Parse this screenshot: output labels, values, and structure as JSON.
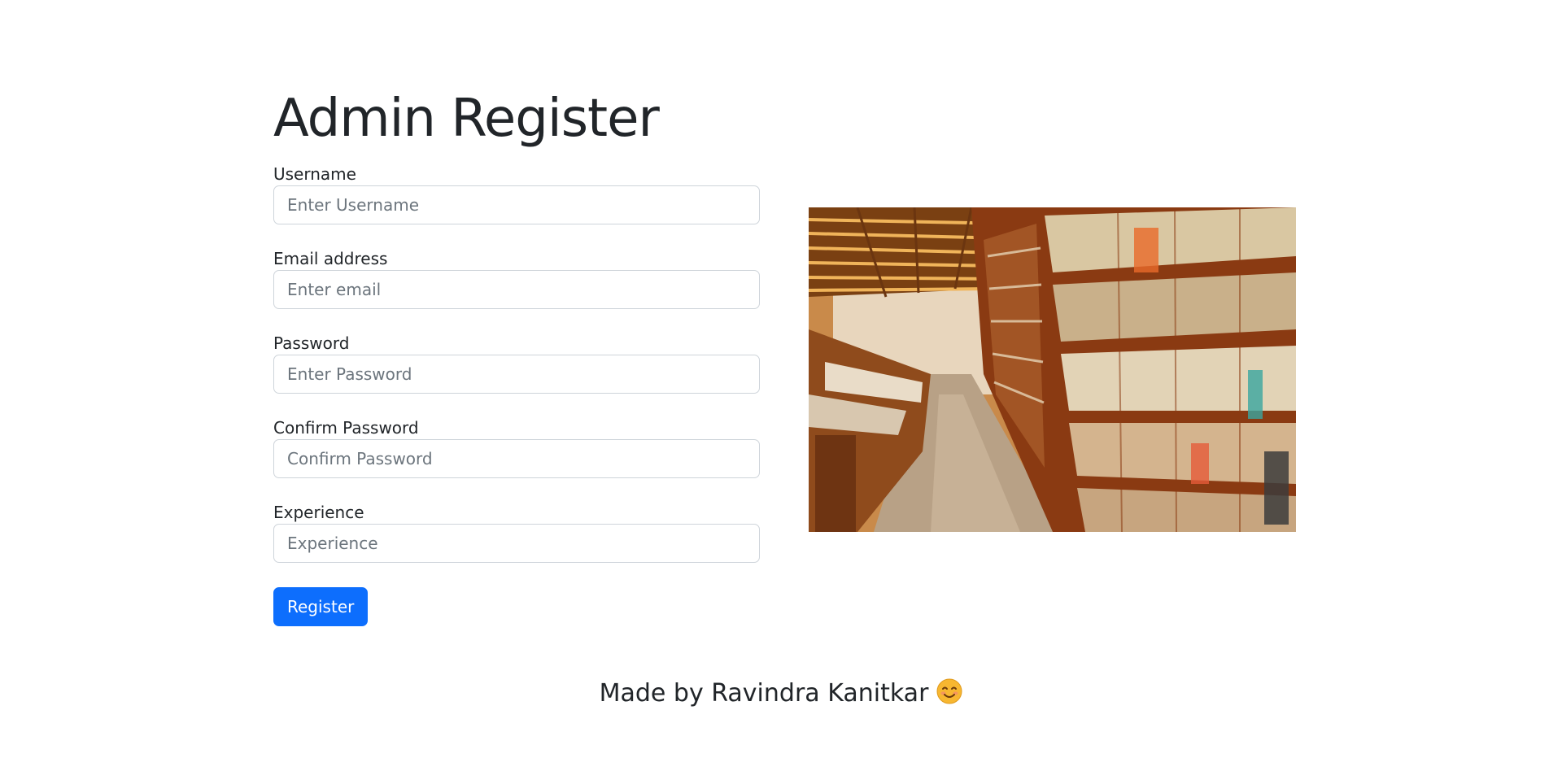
{
  "page": {
    "title": "Admin Register"
  },
  "form": {
    "fields": [
      {
        "label": "Username",
        "placeholder": "Enter Username",
        "value": ""
      },
      {
        "label": "Email address",
        "placeholder": "Enter email",
        "value": ""
      },
      {
        "label": "Password",
        "placeholder": "Enter Password",
        "value": ""
      },
      {
        "label": "Confirm Password",
        "placeholder": "Confirm Password",
        "value": ""
      },
      {
        "label": "Experience",
        "placeholder": "Experience",
        "value": ""
      }
    ],
    "submit_label": "Register"
  },
  "image": {
    "subject": "bookstore-aisle-photo",
    "alt": "Bookstore aisle"
  },
  "footer": {
    "text": "Made by Ravindra Kanitkar",
    "emoji_icon": "smiling-face-icon"
  },
  "colors": {
    "primary": "#0d6efd",
    "text": "#212529",
    "placeholder": "#6c757d",
    "input_border": "#ced4da",
    "shelf_wood": "#8a3a12",
    "ceiling_wood": "#b5651d"
  }
}
